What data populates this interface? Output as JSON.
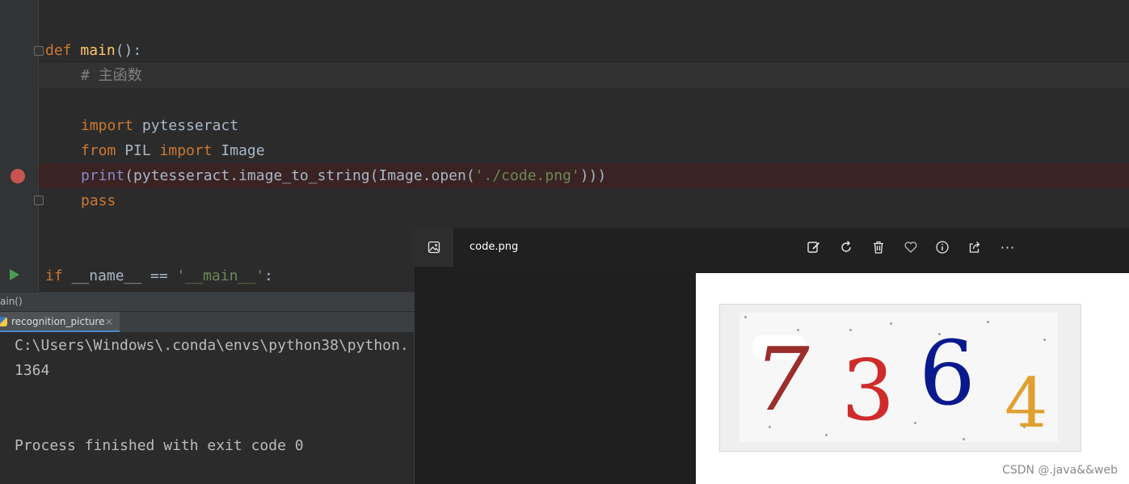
{
  "editor": {
    "lines": {
      "l1": {
        "kw": "def",
        "fn": "main",
        "rest": "():"
      },
      "l2": {
        "comment": "# 主函数"
      },
      "l3": {
        "kw": "import",
        "rest": " pytesseract"
      },
      "l4": {
        "kw1": "from",
        "mid": " PIL ",
        "kw2": "import",
        "rest": " Image"
      },
      "l5": {
        "builtin": "print",
        "pre": "(pytesseract.image_to_string(Image.open(",
        "str": "'./code.png'",
        "post": ")))"
      },
      "l6": {
        "kw": "pass"
      },
      "l7": {
        "kw": "if",
        "mid": " __name__ == ",
        "str": "'__main__'",
        "rest": ":"
      }
    }
  },
  "breadcrumb": {
    "text": "ain()"
  },
  "run_panel": {
    "tab_label": "recognition_picture",
    "close_glyph": "×",
    "output": [
      "C:\\Users\\Windows\\.conda\\envs\\python38\\python.",
      "1364",
      "Process finished with exit code 0"
    ]
  },
  "viewer": {
    "title": "code.png",
    "tools": [
      "edit-icon",
      "rotate-icon",
      "delete-icon",
      "favorite-icon",
      "info-icon",
      "share-icon",
      "more-icon"
    ],
    "more_glyph": "···",
    "captcha_digits": [
      "7",
      "3",
      "6",
      "4"
    ],
    "digit_colors": [
      "#9b2d2d",
      "#d02b2b",
      "#0a1a8c",
      "#e0a030"
    ]
  },
  "watermark": "CSDN @.java&&web",
  "colors": {
    "editor_bg": "#2b2b2b",
    "keyword": "#cc7832",
    "function": "#ffc66d",
    "string": "#6a8759",
    "comment": "#808080",
    "builtin": "#8888c6",
    "breakpoint": "#c75450",
    "run": "#499c54"
  }
}
